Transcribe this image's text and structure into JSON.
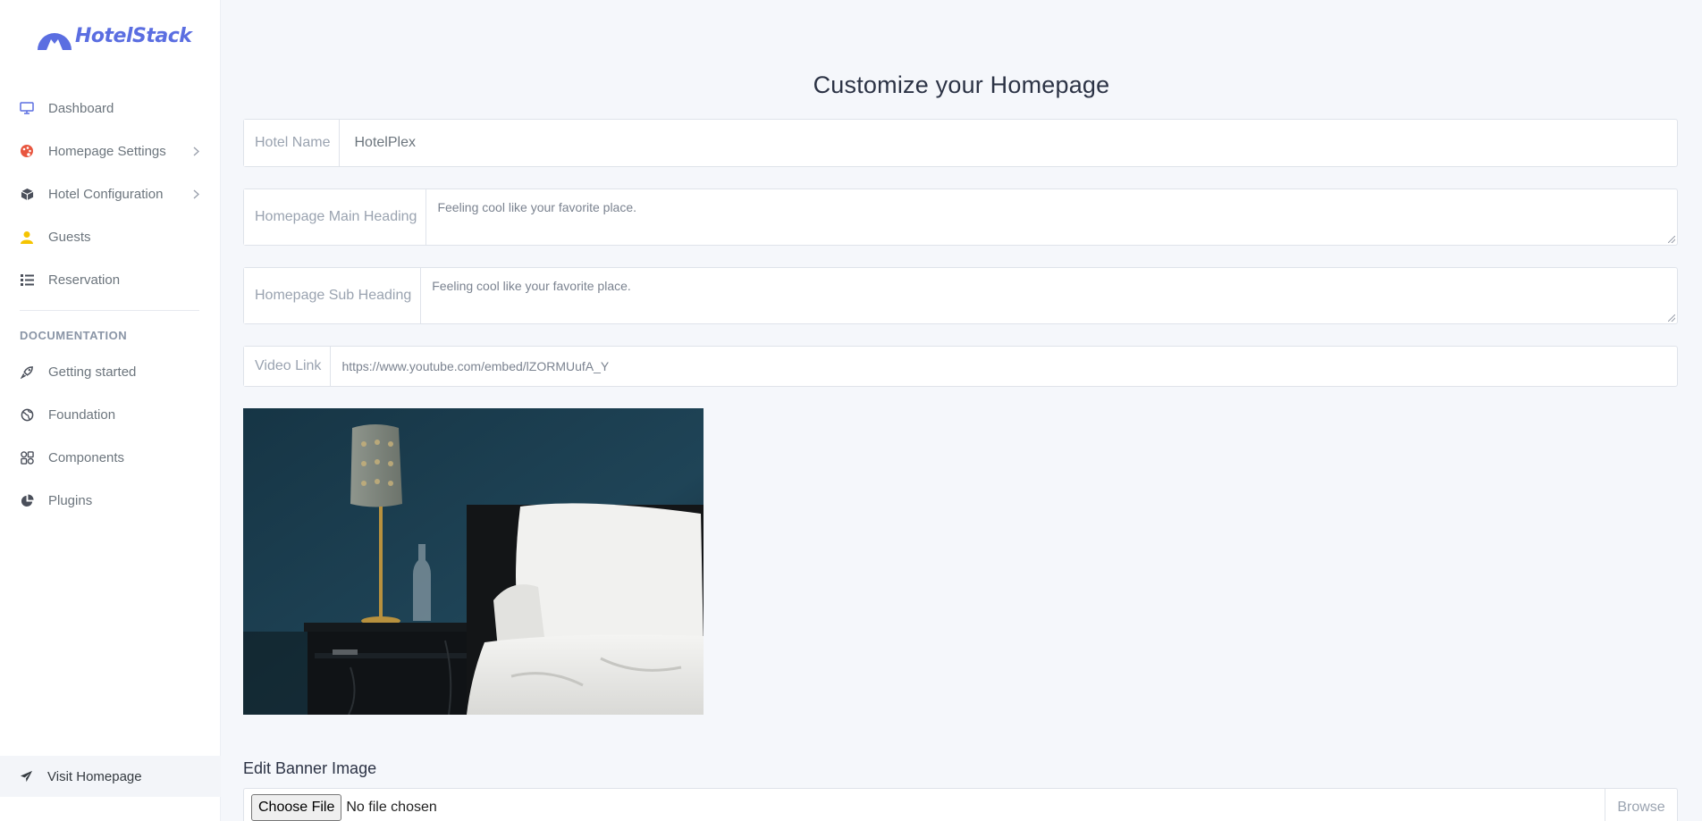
{
  "brand": {
    "name": "HotelStack",
    "color": "#5b6ee1"
  },
  "sidebar": {
    "items": [
      {
        "label": "Dashboard",
        "icon": "monitor-icon"
      },
      {
        "label": "Homepage Settings",
        "icon": "palette-icon",
        "has_children": true
      },
      {
        "label": "Hotel Configuration",
        "icon": "box-icon",
        "has_children": true
      },
      {
        "label": "Guests",
        "icon": "user-icon"
      },
      {
        "label": "Reservation",
        "icon": "list-icon"
      }
    ],
    "doc_title": "DOCUMENTATION",
    "doc_items": [
      {
        "label": "Getting started",
        "icon": "rocket-icon"
      },
      {
        "label": "Foundation",
        "icon": "globe-icon"
      },
      {
        "label": "Components",
        "icon": "components-icon"
      },
      {
        "label": "Plugins",
        "icon": "pie-chart-icon"
      }
    ],
    "visit": {
      "label": "Visit Homepage",
      "icon": "send-icon"
    }
  },
  "main": {
    "title": "Customize your Homepage",
    "hotel_name": {
      "label": "Hotel Name",
      "value": "HotelPlex"
    },
    "main_heading": {
      "label": "Homepage Main Heading",
      "value": "Feeling cool like your favorite place."
    },
    "sub_heading": {
      "label": "Homepage Sub Heading",
      "value": "Feeling cool like your favorite place."
    },
    "video_link": {
      "label": "Video Link",
      "value": "https://www.youtube.com/embed/lZORMUufA_Y"
    },
    "edit_banner_label": "Edit Banner Image",
    "file": {
      "button": "Choose File",
      "status": "No file chosen",
      "browse": "Browse"
    }
  }
}
